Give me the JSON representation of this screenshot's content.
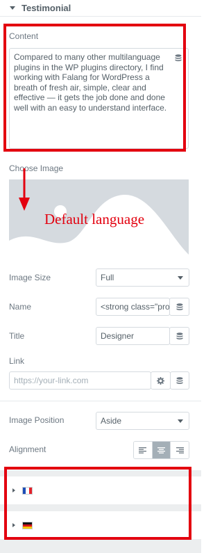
{
  "section": {
    "title": "Testimonial"
  },
  "content": {
    "label": "Content",
    "value": "Compared to many other multilanguage plugins in the WP plugins directory, I find working with Falang for WordPress a breath of fresh air, simple, clear and effective — it gets the job done and done well with an easy to understand interface."
  },
  "image": {
    "label": "Choose Image"
  },
  "image_size": {
    "label": "Image Size",
    "value": "Full"
  },
  "name": {
    "label": "Name",
    "value": "<strong class=\"pro"
  },
  "title_field": {
    "label": "Title",
    "value": "Designer"
  },
  "link": {
    "label": "Link",
    "placeholder": "https://your-link.com"
  },
  "image_position": {
    "label": "Image Position",
    "value": "Aside"
  },
  "alignment": {
    "label": "Alignment",
    "options": [
      "left",
      "center",
      "right"
    ],
    "selected": "center"
  },
  "languages": [
    {
      "flag": "fr",
      "colors": [
        "#1d4eb8",
        "#ffffff",
        "#e3222b"
      ]
    },
    {
      "flag": "de",
      "colors": [
        "#111111",
        "#d7141a",
        "#f7c600"
      ]
    }
  ],
  "annotation": {
    "text": "Default language",
    "color": "#e3000f"
  },
  "colors": {
    "label": "#6d7882",
    "border": "#d5dadf",
    "active": "#a4afb7",
    "panel_gap": "#eceeef"
  },
  "icons": {
    "section_toggle": "caret-down-icon",
    "dynamic_tags": "database-icon",
    "link_options": "gear-icon",
    "row_toggle": "caret-right-icon",
    "annotation_arrow": "arrow-down-icon"
  }
}
